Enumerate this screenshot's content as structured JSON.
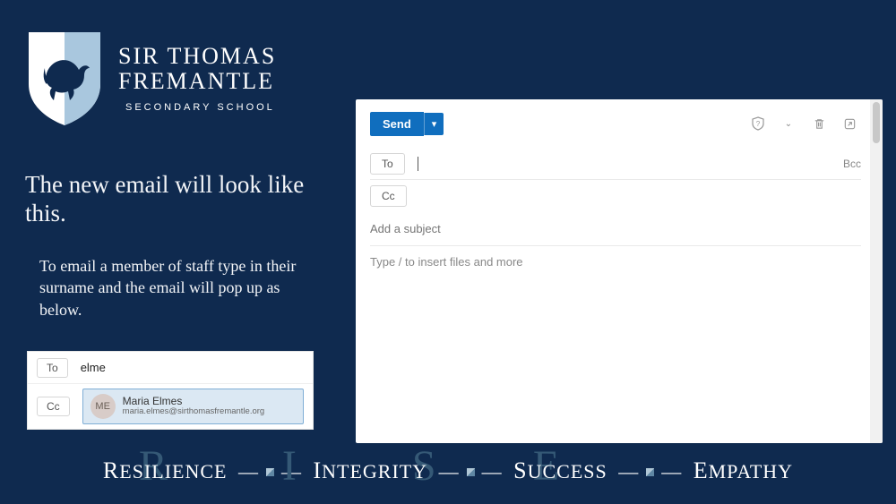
{
  "school": {
    "name_line1": "SIR THOMAS",
    "name_line2": "FREMANTLE",
    "subtitle": "SECONDARY SCHOOL"
  },
  "heading": "The new email will look like this.",
  "body_text": "To email a member of staff type in their surname and the email will pop up as below.",
  "example": {
    "to_label": "To",
    "cc_label": "Cc",
    "typed": "elme",
    "suggestion": {
      "initials": "ME",
      "name": "Maria Elmes",
      "email": "maria.elmes@sirthomasfremantle.org"
    }
  },
  "compose": {
    "send_label": "Send",
    "to_label": "To",
    "cc_label": "Cc",
    "bcc_label": "Bcc",
    "subject_placeholder": "Add a subject",
    "body_placeholder": "Type / to insert files and more"
  },
  "footer": {
    "v1": "Resilience",
    "v2": "Integrity",
    "v3": "Success",
    "v4": "Empathy"
  }
}
